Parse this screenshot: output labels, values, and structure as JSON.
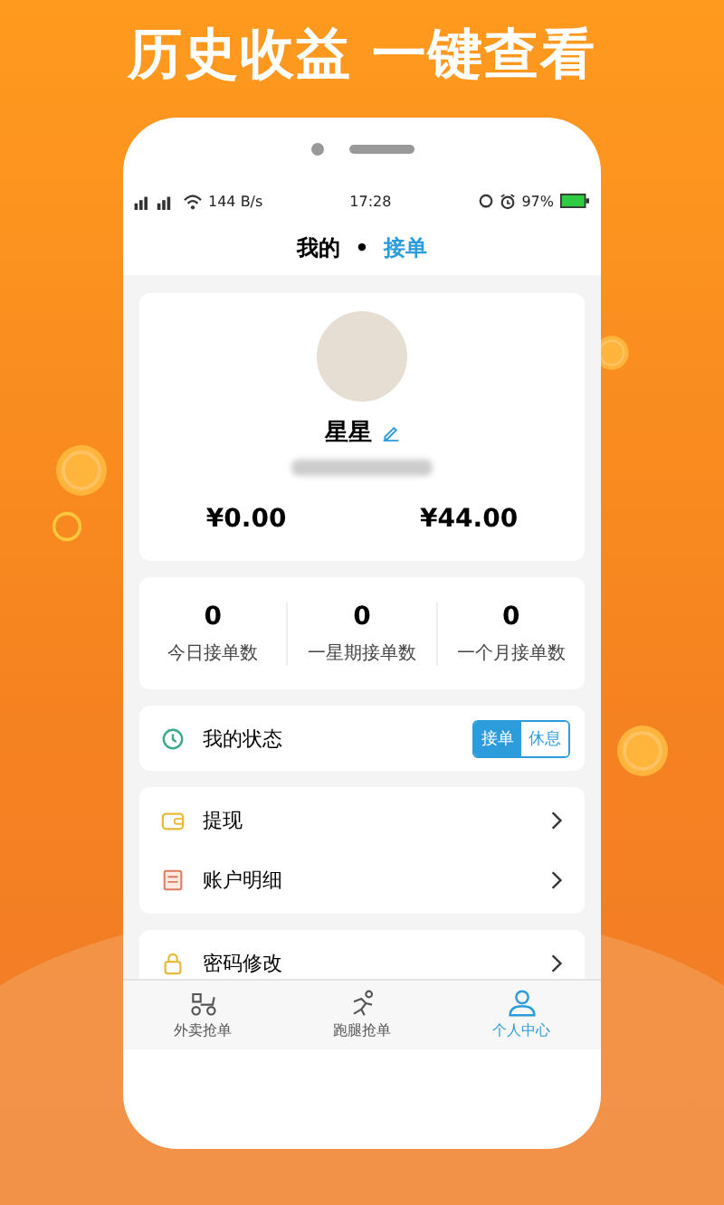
{
  "headline": "历史收益 一键查看",
  "status_bar": {
    "speed": "144 B/s",
    "time": "17:28",
    "battery": "97%"
  },
  "header": {
    "title": "我的",
    "separator": "•",
    "role": "接单"
  },
  "profile": {
    "name": "星星",
    "balances": [
      "¥0.00",
      "¥44.00"
    ]
  },
  "stats": [
    {
      "value": "0",
      "label": "今日接单数"
    },
    {
      "value": "0",
      "label": "一星期接单数"
    },
    {
      "value": "0",
      "label": "一个月接单数"
    }
  ],
  "status": {
    "label": "我的状态",
    "options": [
      {
        "label": "接单",
        "selected": true
      },
      {
        "label": "休息",
        "selected": false
      }
    ]
  },
  "menu_groups": [
    [
      {
        "label": "提现",
        "kind": "wallet"
      },
      {
        "label": "账户明细",
        "kind": "ledger"
      }
    ],
    [
      {
        "label": "密码修改",
        "kind": "lock"
      }
    ]
  ],
  "nav": [
    {
      "label": "外卖抢单",
      "kind": "scooter",
      "selected": false
    },
    {
      "label": "跑腿抢单",
      "kind": "runner",
      "selected": false
    },
    {
      "label": "个人中心",
      "kind": "person",
      "selected": true
    }
  ]
}
